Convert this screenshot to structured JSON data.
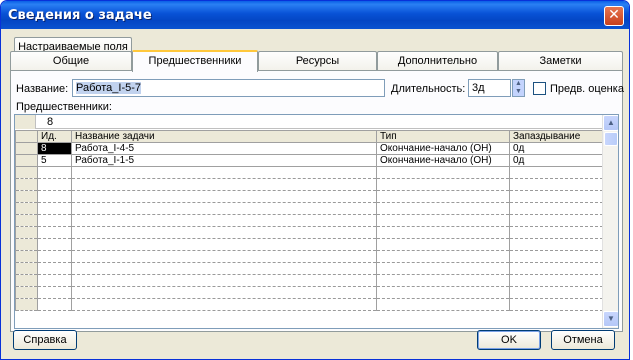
{
  "window": {
    "title": "Сведения о задаче",
    "close_glyph": "✕"
  },
  "tabs_row1": [
    {
      "label": "Настраиваемые поля"
    }
  ],
  "tabs_row2": [
    {
      "label": "Общие"
    },
    {
      "label": "Предшественники",
      "active": true
    },
    {
      "label": "Ресурсы"
    },
    {
      "label": "Дополнительно"
    },
    {
      "label": "Заметки"
    }
  ],
  "form": {
    "name_label": "Название:",
    "name_value": "Работа_I-5-7",
    "duration_label": "Длительность:",
    "duration_value": "3д",
    "estimated_label": "Предв. оценка",
    "estimated_checked": false,
    "predecessors_label": "Предшественники:",
    "edit_value": "8"
  },
  "grid": {
    "columns": [
      "Ид.",
      "Название задачи",
      "Тип",
      "Запаздывание"
    ],
    "rows": [
      {
        "id": "8",
        "name": "Работа_I-4-5",
        "type": "Окончание-начало (ОН)",
        "lag": "0д"
      },
      {
        "id": "5",
        "name": "Работа_I-1-5",
        "type": "Окончание-начало (ОН)",
        "lag": "0д"
      }
    ],
    "empty_rows": 12
  },
  "buttons": {
    "help": "Справка",
    "ok": "OK",
    "cancel": "Отмена"
  },
  "colors": {
    "title_bar": "#0a53d0",
    "face": "#ece9d8",
    "accent_tab": "#ffc83c"
  }
}
